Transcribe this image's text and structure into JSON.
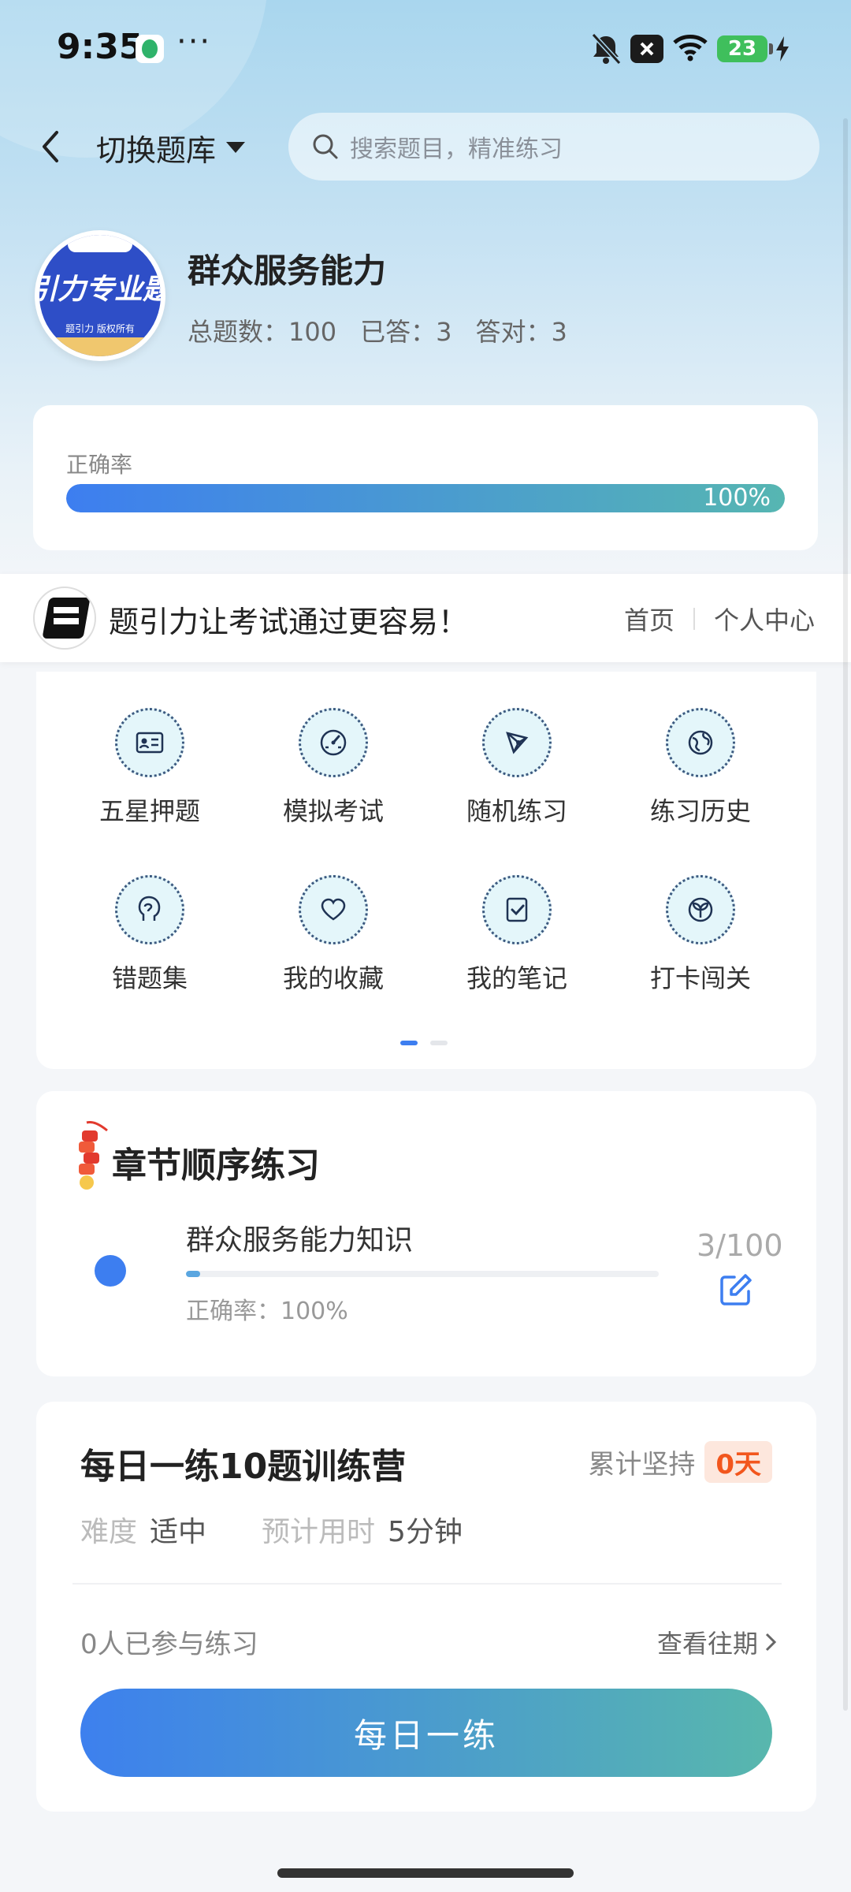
{
  "status_bar": {
    "time": "9:35",
    "dots": "···",
    "battery": "23"
  },
  "header": {
    "switch_label": "切换题库",
    "search_placeholder": "搜索题目，精准练习"
  },
  "bank": {
    "logo_big_text": "引力专业题",
    "logo_small_text": "题引力 版权所有",
    "title": "群众服务能力",
    "stats": [
      {
        "label": "总题数：100"
      },
      {
        "label": "已答：3"
      },
      {
        "label": "答对：3"
      }
    ]
  },
  "accuracy": {
    "label": "正确率",
    "value_text": "100%",
    "fill_fraction": 1.0
  },
  "banner": {
    "text": "题引力让考试通过更容易！",
    "home": "首页",
    "profile": "个人中心"
  },
  "grid": {
    "items": [
      {
        "label": "五星押题",
        "icon": "id-card-icon"
      },
      {
        "label": "模拟考试",
        "icon": "speedometer-icon"
      },
      {
        "label": "随机练习",
        "icon": "network-icon"
      },
      {
        "label": "练习历史",
        "icon": "globe-icon"
      },
      {
        "label": "错题集",
        "icon": "head-icon"
      },
      {
        "label": "我的收藏",
        "icon": "heart-icon"
      },
      {
        "label": "我的笔记",
        "icon": "note-check-icon"
      },
      {
        "label": "打卡闯关",
        "icon": "sprout-icon"
      }
    ],
    "page_count": 2,
    "active_page": 1
  },
  "chapter": {
    "title": "章节顺序练习",
    "name": "群众服务能力知识",
    "accuracy": "正确率：100%",
    "count": "3/100",
    "progress_fraction": 0.03
  },
  "daily": {
    "title": "每日一练10题训练营",
    "persist_label": "累计坚持",
    "persist_value": "0天",
    "difficulty_key": "难度",
    "difficulty_value": "适中",
    "time_key": "预计用时",
    "time_value": "5分钟",
    "participants": "0人已参与练习",
    "history_link": "查看往期",
    "button": "每日一练"
  },
  "colors": {
    "accent": "#3d7ef0",
    "teal": "#56b6b2",
    "badge": "#f2561d"
  }
}
